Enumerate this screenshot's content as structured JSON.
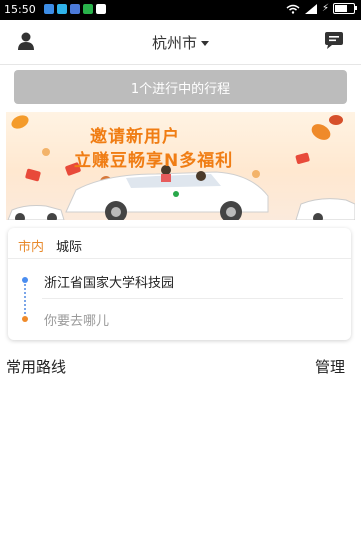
{
  "status_bar": {
    "time": "15:50",
    "notification_icons": [
      "message-icon",
      "chat-icon",
      "mail-icon",
      "wechat-icon",
      "app-icon"
    ],
    "battery_level": 0.6,
    "charging_symbol": "⚡"
  },
  "header": {
    "city": "杭州市"
  },
  "trip_bar": {
    "label": "1个进行中的行程"
  },
  "banner": {
    "line1": "邀请新用户",
    "line2": "立赚豆畅享N多福利"
  },
  "tabs": [
    {
      "label": "市内",
      "active": true
    },
    {
      "label": "城际",
      "active": false
    }
  ],
  "route": {
    "from": "浙江省国家大学科技园",
    "to_placeholder": "你要去哪儿"
  },
  "common_routes": {
    "title": "常用路线",
    "manage_label": "管理"
  },
  "colors": {
    "accent": "#e88a2c",
    "trip_bar": "#bcbcbc",
    "from_dot": "#4a8df0",
    "to_dot": "#ef8a2a"
  }
}
